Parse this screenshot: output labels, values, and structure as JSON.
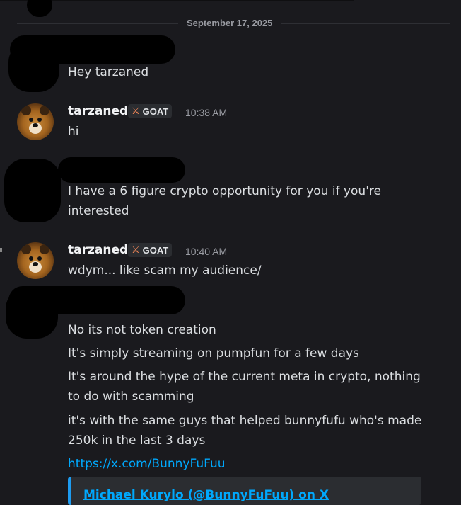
{
  "chat": {
    "date_divider": "September 17, 2025",
    "messages": [
      {
        "lines": [
          "Hey tarzaned"
        ]
      },
      {
        "author": "tarzaned",
        "badge": "GOAT",
        "time": "10:38 AM",
        "lines": [
          "hi"
        ]
      },
      {
        "lines": [
          "I have a 6 figure crypto opportunity for you if you're",
          "interested"
        ]
      },
      {
        "author": "tarzaned",
        "badge": "GOAT",
        "time": "10:40 AM",
        "lines": [
          "wdym... like scam my audience/"
        ]
      },
      {
        "lines": [
          "No its not token creation",
          "It's simply streaming on pumpfun for a few days",
          "It's around the hype of the current meta in crypto, nothing",
          "to do with scamming",
          "it's with the same guys that helped bunnyfufu who's made",
          "250k in the last 3 days"
        ]
      }
    ],
    "link": "https://x.com/BunnyFuFuu",
    "embed_title": "Michael Kurylo (@BunnyFuFuu) on X",
    "badge_icon": "sword-icon",
    "accent_link_color": "#00a8fc"
  }
}
